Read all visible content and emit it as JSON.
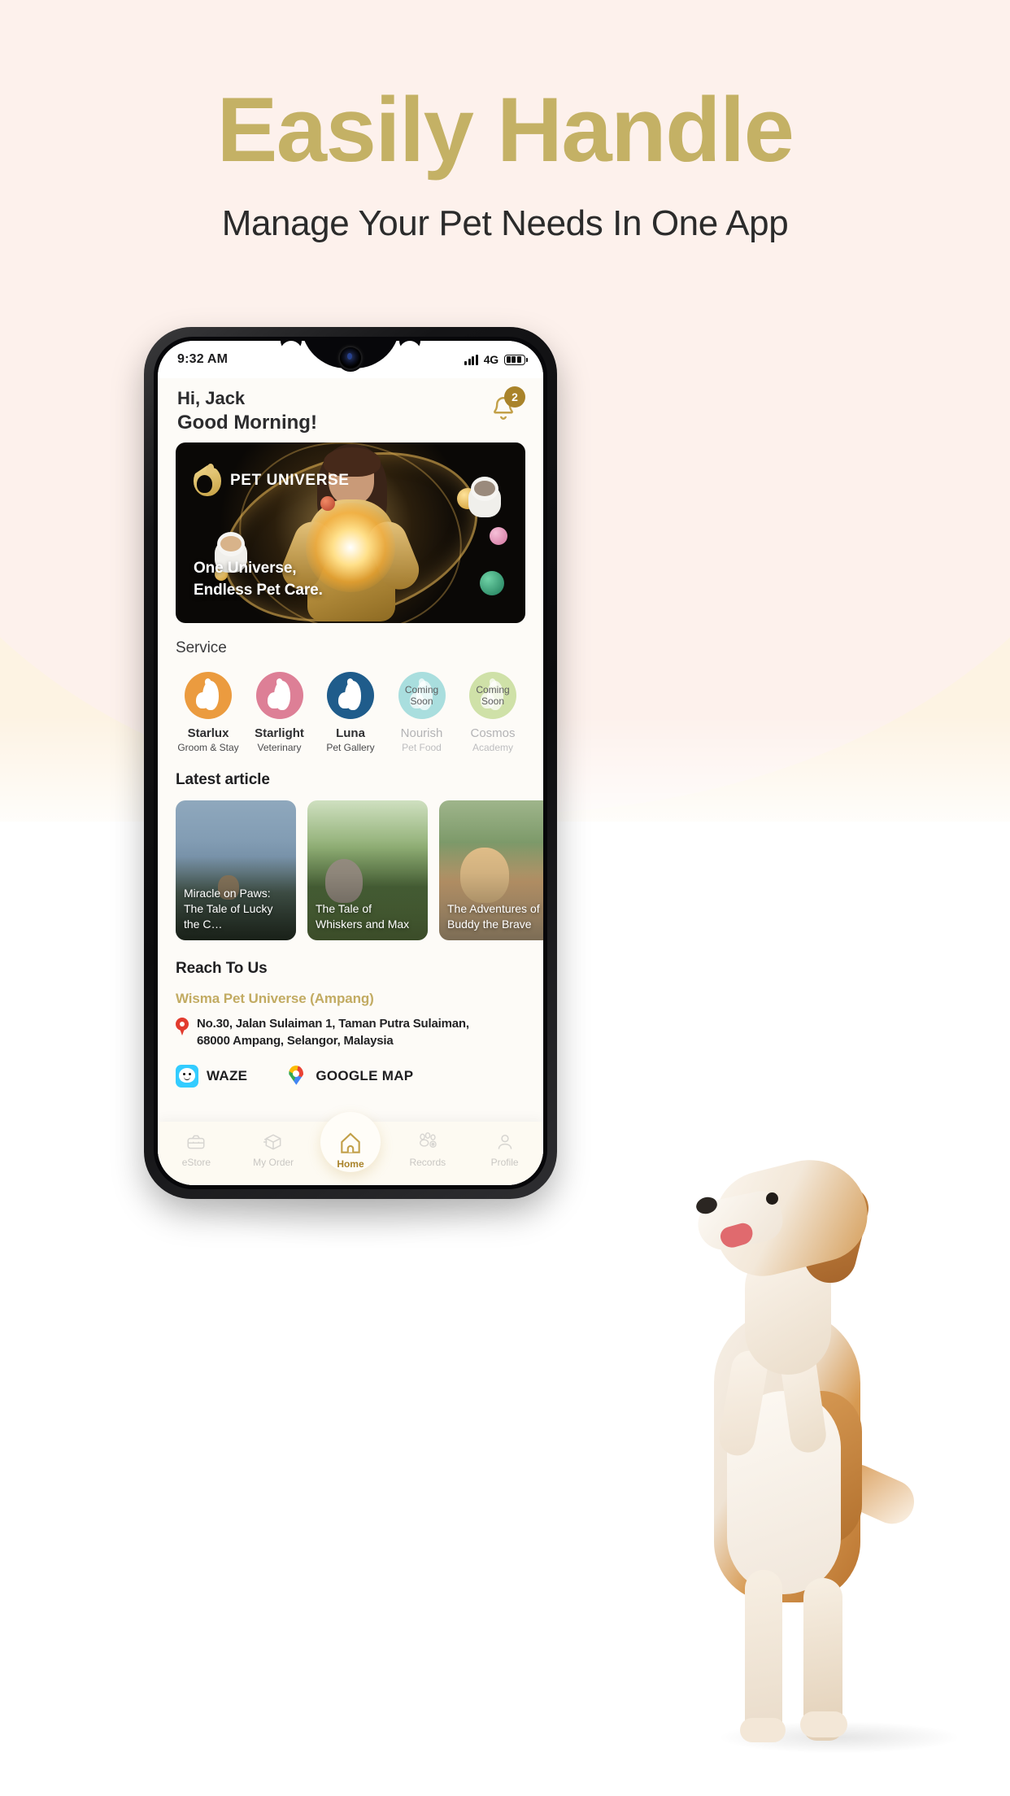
{
  "promo": {
    "title": "Easily Handle",
    "subtitle": "Manage Your Pet Needs In One App",
    "title_color": "#c4b165"
  },
  "phone": {
    "status": {
      "time": "9:32 AM",
      "network": "4G",
      "signal_icon": "signal-bars-icon",
      "battery_icon": "battery-icon"
    },
    "header": {
      "greeting_name": "Hi, Jack",
      "greeting_time": "Good Morning!",
      "bell_icon": "notification-bell-icon",
      "bell_badge": "2"
    },
    "banner": {
      "brand": "PET UNIVERSE",
      "logo_icon": "pet-universe-cat-logo-icon",
      "tagline_line1": "One Universe,",
      "tagline_line2": "Endless Pet Care."
    },
    "service": {
      "title": "Service",
      "items": [
        {
          "name": "Starlux",
          "sub": "Groom & Stay",
          "color": "#eb9b3f",
          "icon": "cat-silhouette-icon",
          "coming_soon": "",
          "dim": false
        },
        {
          "name": "Starlight",
          "sub": "Veterinary",
          "color": "#dd7f96",
          "icon": "cat-silhouette-icon",
          "coming_soon": "",
          "dim": false
        },
        {
          "name": "Luna",
          "sub": "Pet Gallery",
          "color": "#1f5c8b",
          "icon": "cat-silhouette-icon",
          "coming_soon": "",
          "dim": false
        },
        {
          "name": "Nourish",
          "sub": "Pet Food",
          "color": "#a9dede",
          "icon": "cat-silhouette-icon",
          "coming_soon": "Coming\nSoon",
          "dim": true
        },
        {
          "name": "Cosmos",
          "sub": "Academy",
          "color": "#cfe1a8",
          "icon": "cat-silhouette-icon",
          "coming_soon": "Coming\nSoon",
          "dim": true
        }
      ]
    },
    "articles": {
      "title": "Latest article",
      "items": [
        {
          "title": "Miracle on Paws: The Tale of Lucky the C…"
        },
        {
          "title": "The Tale of Whiskers and Max"
        },
        {
          "title": "The Adventures of Buddy the Brave"
        }
      ]
    },
    "reach": {
      "title": "Reach To Us",
      "place": "Wisma Pet Universe (Ampang)",
      "pin_icon": "location-pin-icon",
      "address_line1": "No.30, Jalan Sulaiman 1, Taman Putra Sulaiman,",
      "address_line2": "68000 Ampang, Selangor, Malaysia",
      "maps": [
        {
          "label": "WAZE",
          "icon": "waze-icon"
        },
        {
          "label": "GOOGLE MAP",
          "icon": "google-maps-icon"
        }
      ]
    },
    "nav": {
      "items": [
        {
          "label": "eStore",
          "icon": "pet-carrier-icon",
          "active": false
        },
        {
          "label": "My Order",
          "icon": "package-box-icon",
          "active": false
        },
        {
          "label": "Home",
          "icon": "home-icon",
          "active": true
        },
        {
          "label": "Records",
          "icon": "paw-rec-icon",
          "active": false
        },
        {
          "label": "Profile",
          "icon": "user-person-icon",
          "active": false
        }
      ]
    }
  },
  "decor": {
    "dog_image": "jumping-beagle-dog-photo"
  }
}
